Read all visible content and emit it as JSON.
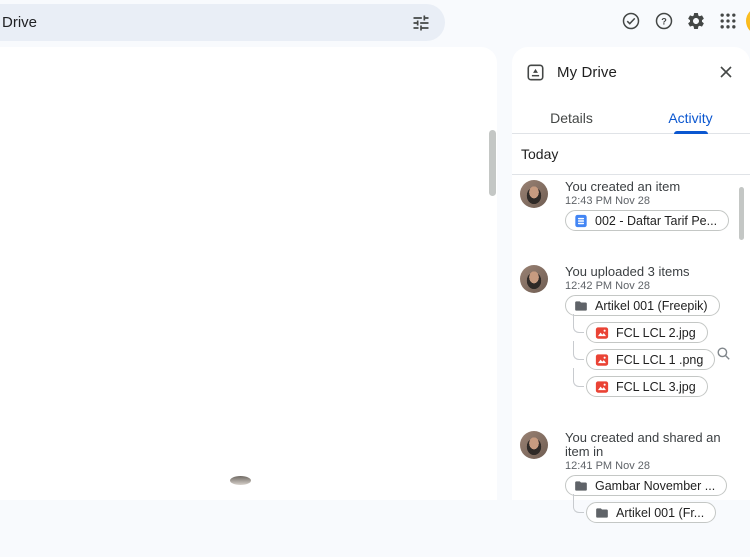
{
  "topbar": {
    "search_value": "Drive",
    "tune_icon": "tune-filters-icon",
    "action_icons": [
      "offline-ready-icon",
      "help-icon",
      "settings-icon",
      "apps-grid-icon",
      "profile-avatar"
    ]
  },
  "panel": {
    "header_icon": "my-drive-icon",
    "title": "My Drive",
    "close_icon": "close-icon",
    "tabs": [
      {
        "label": "Details",
        "active": false
      },
      {
        "label": "Activity",
        "active": true
      }
    ],
    "section_title": "Today",
    "activities": [
      {
        "action": "You created an item",
        "timestamp": "12:43 PM Nov 28",
        "items": [
          {
            "type": "doc",
            "icon": "google-doc-icon",
            "label": "002 - Daftar Tarif Pe...",
            "nested": false
          }
        ]
      },
      {
        "action": "You uploaded 3 items",
        "timestamp": "12:42 PM Nov 28",
        "items": [
          {
            "type": "folder",
            "icon": "folder-icon",
            "label": "Artikel 001 (Freepik)",
            "nested": false
          },
          {
            "type": "image",
            "icon": "image-file-icon",
            "label": "FCL LCL 2.jpg",
            "nested": true
          },
          {
            "type": "image",
            "icon": "image-file-icon",
            "label": "FCL LCL 1 .png",
            "nested": true
          },
          {
            "type": "image",
            "icon": "image-file-icon",
            "label": "FCL LCL 3.jpg",
            "nested": true
          }
        ]
      },
      {
        "action": "You created and shared an item in",
        "timestamp": "12:41 PM Nov 28",
        "items": [
          {
            "type": "folder",
            "icon": "folder-icon",
            "label": "Gambar November ...",
            "nested": false
          },
          {
            "type": "folder",
            "icon": "folder-icon",
            "label": "Artikel 001 (Fr...",
            "nested": true
          }
        ]
      }
    ],
    "floating_icon": "magnifier-icon"
  },
  "colors": {
    "page_bg": "#f8fafd",
    "search_bg": "#e9eef6",
    "accent_blue": "#0b57d0",
    "doc_blue": "#4285f4",
    "image_red": "#ea4335",
    "folder_gray": "#5f6368",
    "chip_border": "#c4c7c5",
    "icon_gray": "#444746",
    "profile_yellow": "#f9ab00"
  }
}
